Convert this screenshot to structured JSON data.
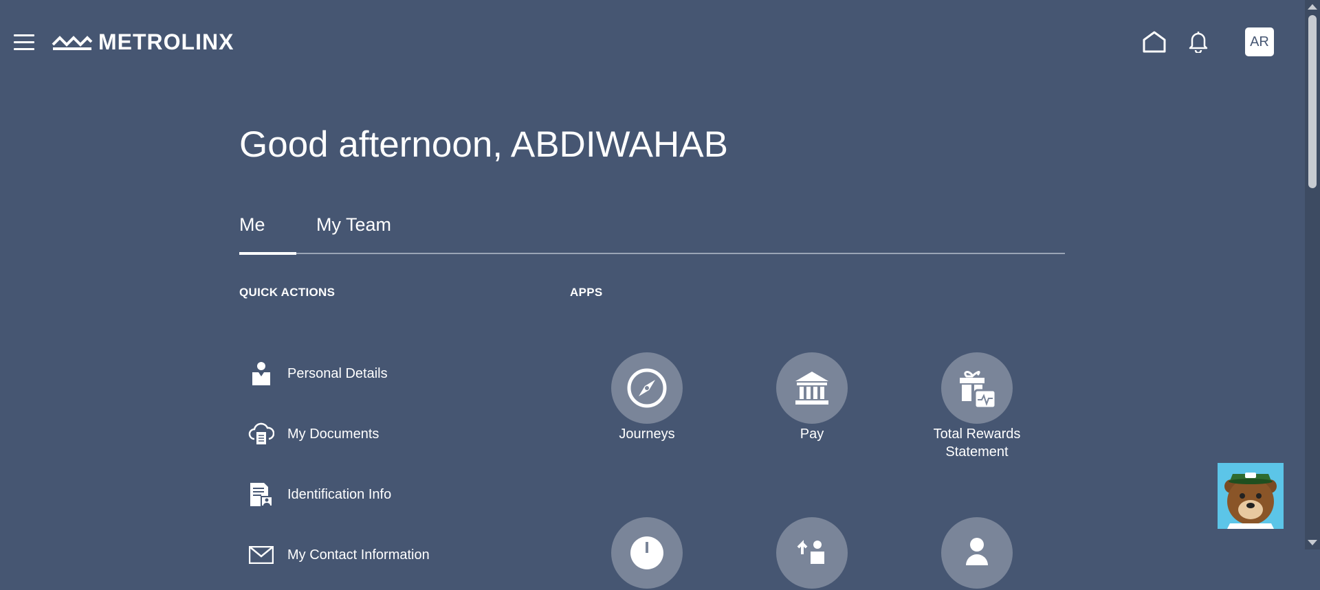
{
  "header": {
    "logo_text": "METROLINX",
    "menu_icon": "hamburger-icon",
    "home_icon": "home-icon",
    "notifications_icon": "bell-icon",
    "avatar_initials": "AR"
  },
  "greeting": "Good afternoon, ABDIWAHAB",
  "tabs": [
    {
      "label": "Me",
      "active": true
    },
    {
      "label": "My Team",
      "active": false
    }
  ],
  "quick_actions": {
    "title": "QUICK ACTIONS",
    "items": [
      {
        "label": "Personal Details",
        "icon": "person-icon"
      },
      {
        "label": "My Documents",
        "icon": "cloud-document-icon"
      },
      {
        "label": "Identification Info",
        "icon": "id-document-icon"
      },
      {
        "label": "My Contact Information",
        "icon": "envelope-icon"
      }
    ]
  },
  "apps": {
    "title": "APPS",
    "items": [
      {
        "label": "Journeys",
        "icon": "compass-icon"
      },
      {
        "label": "Pay",
        "icon": "bank-icon"
      },
      {
        "label": "Total Rewards Statement",
        "icon": "gift-icon"
      },
      {
        "label": "",
        "icon": "clock-icon"
      },
      {
        "label": "",
        "icon": "people-transfer-icon"
      },
      {
        "label": "",
        "icon": "person-icon"
      }
    ]
  },
  "colors": {
    "background": "#465672",
    "app_circle": "#7a8599",
    "text": "#ffffff"
  }
}
